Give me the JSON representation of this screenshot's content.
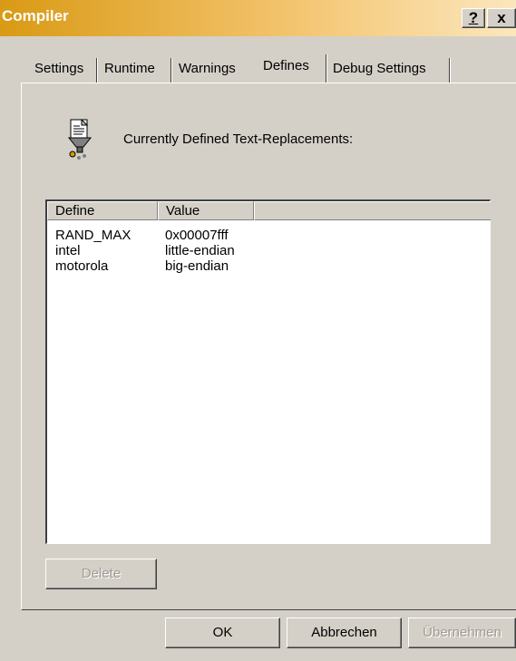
{
  "window": {
    "title": "Compiler",
    "help_label": "?",
    "close_label": "x"
  },
  "tabs": [
    {
      "label": "Settings",
      "active": false
    },
    {
      "label": "Runtime",
      "active": false
    },
    {
      "label": "Warnings",
      "active": false
    },
    {
      "label": "Defines",
      "active": true
    },
    {
      "label": "Debug Settings",
      "active": false
    }
  ],
  "page": {
    "heading": "Currently Defined Text-Replacements:",
    "icon": "document-funnel-icon"
  },
  "list": {
    "columns": [
      "Define",
      "Value",
      ""
    ],
    "rows": [
      {
        "define": "RAND_MAX",
        "value": "0x00007fff"
      },
      {
        "define": "intel",
        "value": "little-endian"
      },
      {
        "define": "motorola",
        "value": "big-endian"
      }
    ]
  },
  "buttons": {
    "delete": {
      "label": "Delete",
      "enabled": false
    },
    "ok": {
      "label": "OK",
      "enabled": true
    },
    "cancel": {
      "label": "Abbrechen",
      "enabled": true
    },
    "apply": {
      "label": "Übernehmen",
      "enabled": false
    }
  },
  "colors": {
    "titlebar_start": "#d99a14",
    "titlebar_end": "#fbe7bd",
    "face": "#d4d0c8"
  }
}
